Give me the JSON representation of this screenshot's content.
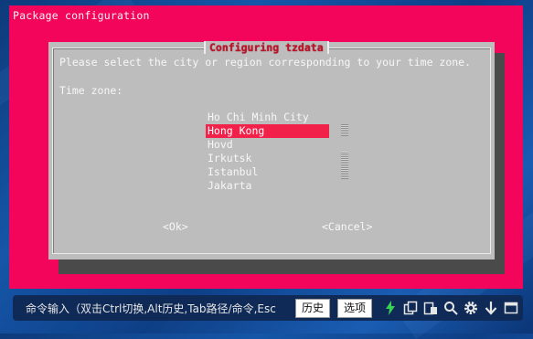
{
  "terminal": {
    "title": "Package configuration"
  },
  "dialog": {
    "title": "Configuring tzdata",
    "prompt": "Please select the city or region corresponding to your time zone.",
    "field_label": "Time zone:",
    "items": [
      {
        "label": "Ho Chi Minh City"
      },
      {
        "label": "Hong Kong"
      },
      {
        "label": "Hovd"
      },
      {
        "label": "Irkutsk"
      },
      {
        "label": "Istanbul"
      },
      {
        "label": "Jakarta"
      }
    ],
    "selected_item": "Hong Kong",
    "ok_label": "<Ok>",
    "cancel_label": "<Cancel>"
  },
  "commandbar": {
    "input_text": "命令输入（双击Ctrl切换,Alt历史,Tab路径/命令,Esc",
    "history_label": "历史",
    "options_label": "选项",
    "icons": [
      "lightning-icon",
      "copy-icon",
      "paste-icon",
      "search-icon",
      "gear-icon",
      "download-icon",
      "window-icon"
    ]
  },
  "colors": {
    "terminal_bg": "#f2055a",
    "dialog_bg": "#bdbdbd",
    "dialog_title": "#c1122a",
    "selection_bg": "#f2214a",
    "lightning": "#39d353"
  }
}
